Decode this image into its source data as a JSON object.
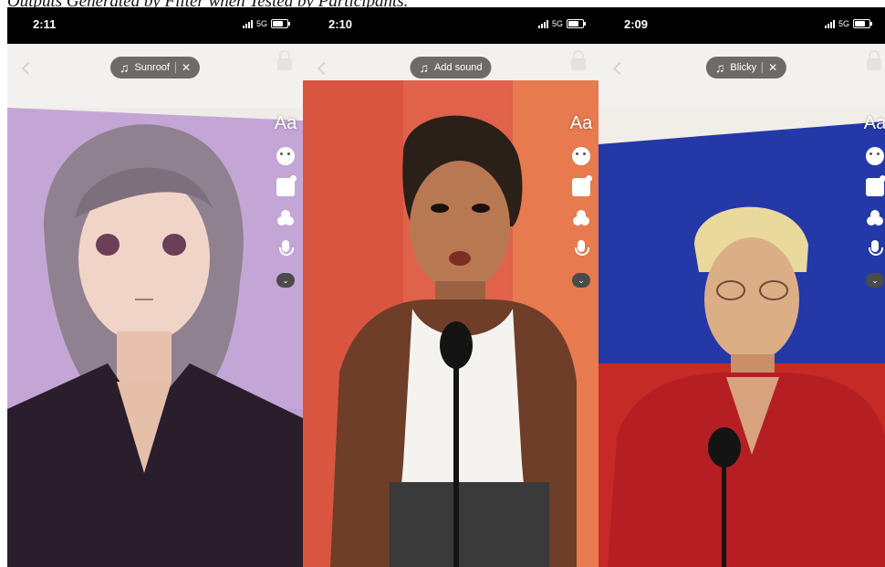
{
  "caption": "Outputs Generated by Filter when Tested by Participants.",
  "phones": [
    {
      "time": "2:11",
      "network": "5G",
      "sound_label": "Sunroof",
      "has_close": true
    },
    {
      "time": "2:10",
      "network": "5G",
      "sound_label": "Add sound",
      "has_close": false
    },
    {
      "time": "2:09",
      "network": "5G",
      "sound_label": "Blicky",
      "has_close": true
    }
  ],
  "rail": {
    "text_tool": "Aa",
    "more": "⌄"
  },
  "icons": [
    "back-chevron-icon",
    "music-note-icon",
    "close-icon",
    "lock-icon",
    "text-tool-icon",
    "effects-icon",
    "sticker-icon",
    "filters-icon",
    "voiceover-icon",
    "more-chevron-icon",
    "signal-icon",
    "battery-icon"
  ],
  "colors": {
    "pill_bg": "#6e6a68",
    "status_bar": "#000000",
    "top_bg": "#f3f1ef"
  }
}
